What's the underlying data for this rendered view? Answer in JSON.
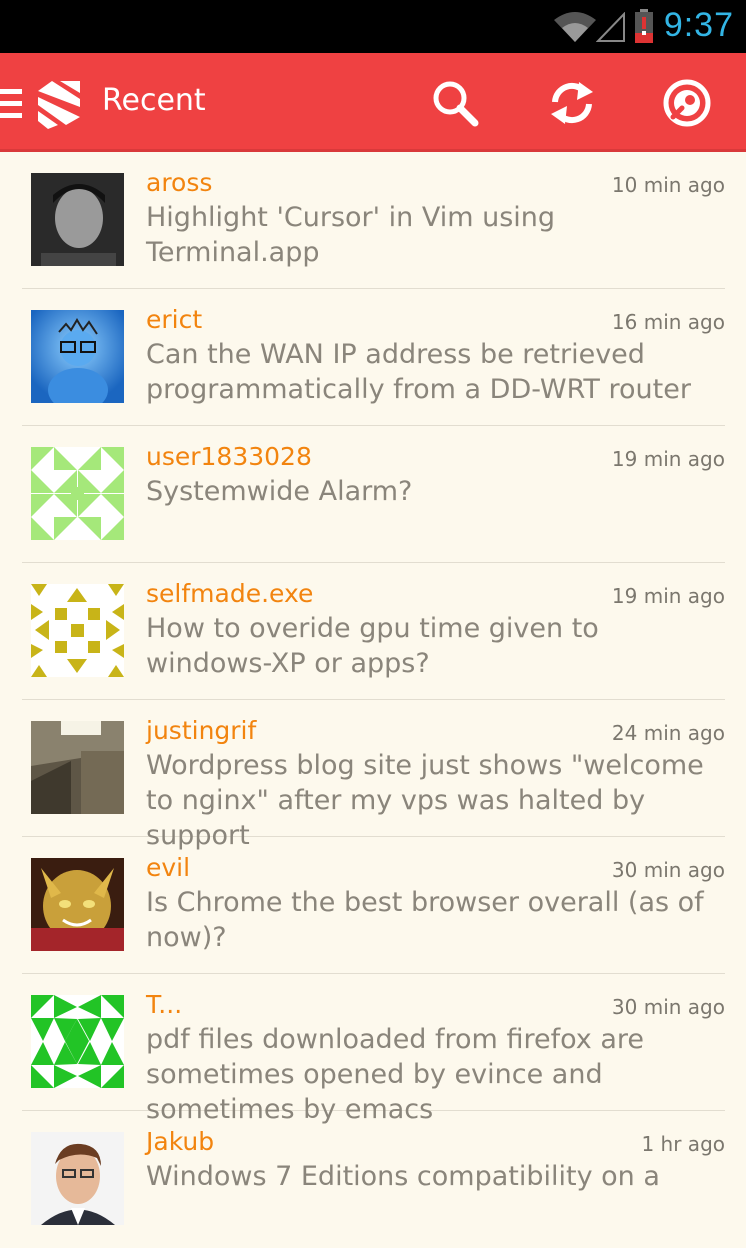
{
  "status_bar": {
    "time": "9:37",
    "icons": [
      "wifi-icon",
      "signal-icon",
      "battery-alert-icon"
    ],
    "clock_color": "#33b5e5"
  },
  "action_bar": {
    "title": "Recent",
    "color": "#ef4142",
    "icons": [
      "menu-icon",
      "stack-logo-icon",
      "search-icon",
      "refresh-icon",
      "settings-icon"
    ]
  },
  "colors": {
    "username": "#f2840f",
    "question": "#8a857b",
    "background": "#fdf9ed"
  },
  "questions": [
    {
      "user": "aross",
      "time": "10 min ago",
      "title": "Highlight 'Cursor' in Vim using Terminal.app"
    },
    {
      "user": "erict",
      "time": "16 min ago",
      "title": "Can the WAN IP address be retrieved programmatically from a DD-WRT router"
    },
    {
      "user": "user1833028",
      "time": "19 min ago",
      "title": "Systemwide Alarm?"
    },
    {
      "user": "selfmade.exe",
      "time": "19 min ago",
      "title": "How to overide gpu time given to windows-XP or apps?"
    },
    {
      "user": "justingrif",
      "time": "24 min ago",
      "title": "Wordpress blog site just shows \"welcome to nginx\" after my vps was halted by support"
    },
    {
      "user": "evil",
      "time": "30 min ago",
      "title": "Is Chrome the best browser overall (as of now)?"
    },
    {
      "user": "T...",
      "time": "30 min ago",
      "title": "pdf files downloaded from firefox are sometimes opened by evince and sometimes by emacs"
    },
    {
      "user": "Jakub",
      "time": "1 hr ago",
      "title": "Windows 7 Editions compatibility on a"
    }
  ]
}
